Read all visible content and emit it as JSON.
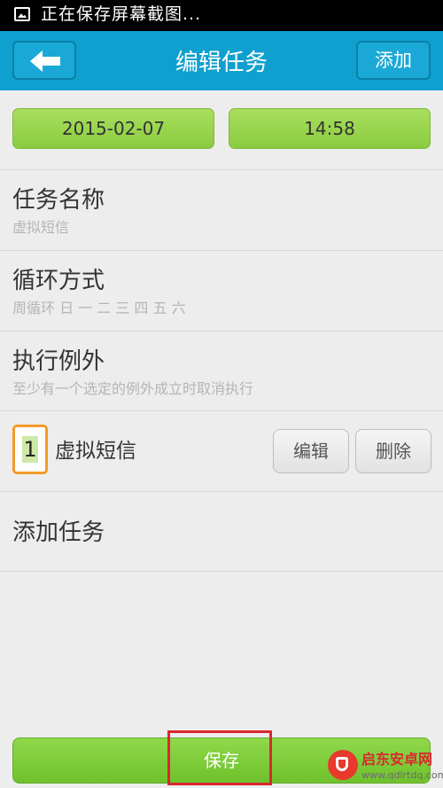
{
  "status_bar": {
    "text": "正在保存屏幕截图...",
    "icon": "screenshot-icon"
  },
  "header": {
    "title": "编辑任务",
    "back_icon": "back-arrow-icon",
    "add_label": "添加"
  },
  "schedule": {
    "date": "2015-02-07",
    "time": "14:58"
  },
  "rows": [
    {
      "title": "任务名称",
      "subtitle": "虚拟短信"
    },
    {
      "title": "循环方式",
      "subtitle": "周循环 日 一 二 三 四 五 六"
    },
    {
      "title": "执行例外",
      "subtitle": "至少有一个选定的例外成立时取消执行"
    }
  ],
  "task_item": {
    "index": "1",
    "label": "虚拟短信",
    "edit_label": "编辑",
    "delete_label": "删除"
  },
  "add_task_label": "添加任务",
  "footer": {
    "save_label": "保存"
  },
  "watermark": {
    "name": "启东安卓网",
    "url": "www.qdlrtdq.com"
  },
  "colors": {
    "titlebar": "#0fa0cf",
    "green_button": "#8acb40",
    "highlight": "#d9282f",
    "badge_border": "#f39a2a"
  }
}
